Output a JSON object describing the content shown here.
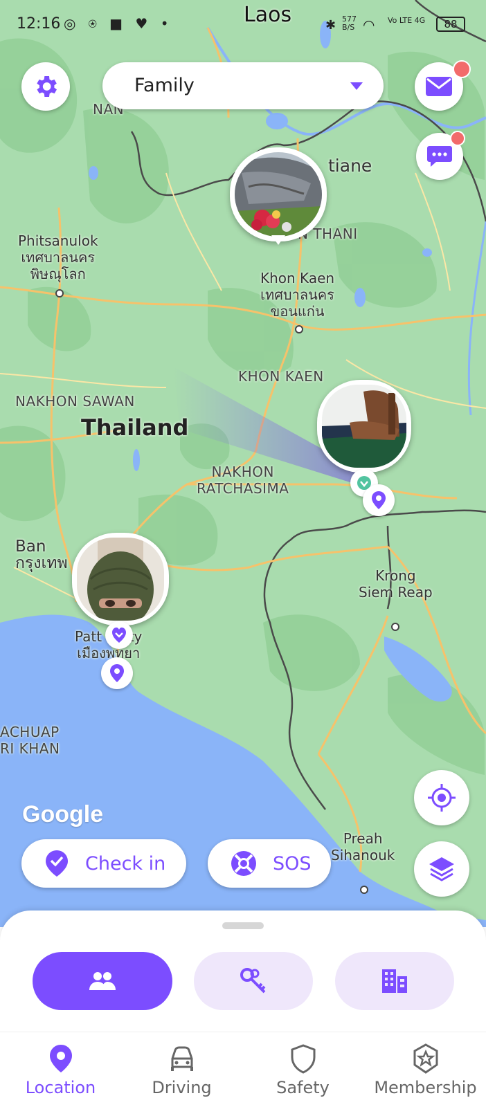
{
  "status_bar": {
    "time": "12:16",
    "left_icons": "◎ ⍟ ■ ♥ •",
    "network_speed": "577 B/S",
    "right_icons": "Vo LTE 4G",
    "battery": "88"
  },
  "header": {
    "circle_name": "Family"
  },
  "map": {
    "labels": {
      "laos": "Laos",
      "nan": "NAN",
      "vientiane": "tiane",
      "udon_thani": "N THANI",
      "phitsanulok": "Phitsanulok\nเทศบาลนคร\nพิษณุโลก",
      "khon_kaen_city": "Khon Kaen\nเทศบาลนคร\nขอนแก่น",
      "khon_kaen_province": "KHON KAEN",
      "nakhon_sawan": "NAKHON SAWAN",
      "thailand": "Thailand",
      "nakhon_ratchasima": "NAKHON\nRATCHASIMA",
      "bangkok": "Ban\nกรุงเทพ",
      "pattaya": "Patt   City\nเมืองพทยา",
      "krong_siem_reap": "Krong\nSiem Reap",
      "prachuap": "ACHUAP\nRI KHAN",
      "preah_sihanouk": "Preah\nSihanouk"
    },
    "google": "Google"
  },
  "actions": {
    "check_in": "Check in",
    "sos": "SOS"
  },
  "nav": {
    "items": [
      {
        "label": "Location",
        "icon": "location-pin-icon",
        "active": true
      },
      {
        "label": "Driving",
        "icon": "car-icon",
        "active": false
      },
      {
        "label": "Safety",
        "icon": "shield-icon",
        "active": false
      },
      {
        "label": "Membership",
        "icon": "star-badge-icon",
        "active": false
      }
    ]
  },
  "colors": {
    "accent": "#7c4dff",
    "accent_light": "#efe7fb",
    "badge": "#f26b6b",
    "land": "#a9dcae",
    "water": "#8ab4f8"
  }
}
